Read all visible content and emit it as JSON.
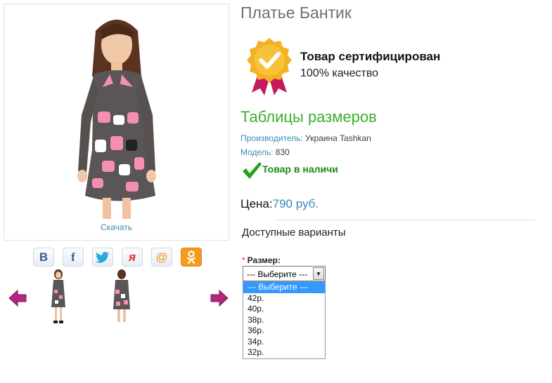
{
  "product": {
    "title": "Платье Бантик",
    "download_label": "Скачать",
    "certified_title": "Товар сертифицирован",
    "certified_sub": "100% качество",
    "size_tables_label": "Таблицы размеров",
    "manufacturer_key": "Производитель:",
    "manufacturer_value": "Украина Tashkan",
    "model_key": "Модель:",
    "model_value": "830",
    "stock_label": "Товар в наличи",
    "price_key": "Цена:",
    "price_value": "790 руб."
  },
  "social": [
    {
      "name": "vk",
      "label": "B",
      "color": "#3b5998"
    },
    {
      "name": "facebook",
      "label": "f",
      "color": "#3b5998"
    },
    {
      "name": "twitter",
      "label": "",
      "color": "#2aa9e0"
    },
    {
      "name": "yandex",
      "label": "я",
      "color": "#e52b2b"
    },
    {
      "name": "mail",
      "label": "@",
      "color": "#f39c1e"
    },
    {
      "name": "odnoklassniki",
      "label": "ok",
      "color": "#f39c1e"
    }
  ],
  "options": {
    "section_title": "Доступные варианты",
    "size_required_mark": "*",
    "size_label": "Размер:",
    "selected": "--- Выберите ---",
    "items": [
      "--- Выберите ---",
      "42р.",
      "40р.",
      "38р.",
      "36р.",
      "34р.",
      "32р."
    ]
  },
  "colors": {
    "link": "#3a8ab5",
    "green": "#3cae2d",
    "arrow": "#b0287a",
    "select_highlight": "#3399ff"
  }
}
